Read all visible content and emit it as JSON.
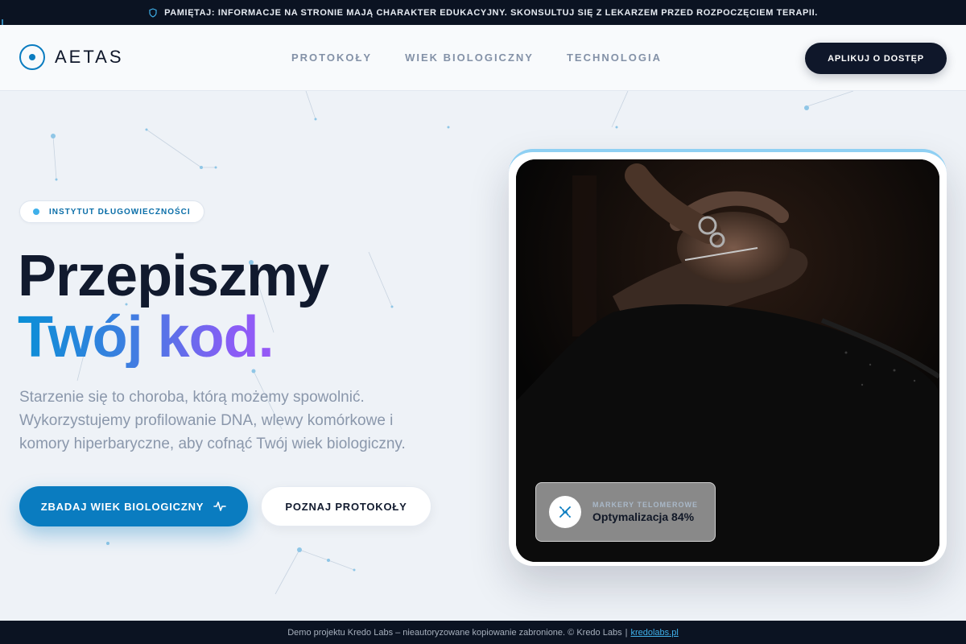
{
  "topbar": {
    "notice": "PAMIĘTAJ: INFORMACJE NA STRONIE MAJĄ CHARAKTER EDUKACYJNY. SKONSULTUJ SIĘ Z LEKARZEM PRZED ROZPOCZĘCIEM TERAPII."
  },
  "nav": {
    "brand": "AETAS",
    "items": [
      {
        "label": "PROTOKOŁY"
      },
      {
        "label": "WIEK BIOLOGICZNY"
      },
      {
        "label": "TECHNOLOGIA"
      }
    ],
    "cta": "APLIKUJ O DOSTĘP"
  },
  "hero": {
    "badge": "INSTYTUT DŁUGOWIECZNOŚCI",
    "title_line1": "Przepiszmy",
    "title_line2": "Twój kod.",
    "lead": "Starzenie się to choroba, którą możemy spowolnić. Wykorzystujemy profilowanie DNA, wlewy komórkowe i komory hiperbaryczne, aby cofnąć Twój wiek biologiczny.",
    "primary_button": "ZBADAJ WIEK BIOLOGICZNY",
    "secondary_button": "POZNAJ PROTOKOŁY"
  },
  "stat_card": {
    "kicker": "MARKERY TELOMEROWE",
    "value": "Optymalizacja 84%",
    "icon": "dna-icon"
  },
  "footer": {
    "text": "Demo projektu Kredo Labs – nieautoryzowane kopiowanie zabronione. © Kredo Labs",
    "separator": "|",
    "link": "kredolabs.pl"
  },
  "colors": {
    "primary": "#0a7cc0",
    "dark": "#0f172a",
    "gradient_start": "#0a8fd6",
    "gradient_end": "#a855f7",
    "accent_blue": "#3fb0ea"
  }
}
